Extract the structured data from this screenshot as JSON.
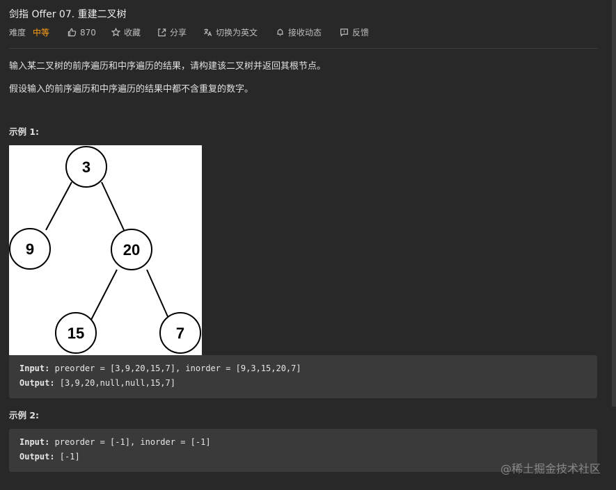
{
  "problem": {
    "title": "剑指 Offer 07. 重建二叉树",
    "difficulty_label": "难度",
    "difficulty_value": "中等",
    "likes": "870",
    "favorite_label": "收藏",
    "share_label": "分享",
    "language_label": "切换为英文",
    "notify_label": "接收动态",
    "feedback_label": "反馈"
  },
  "description": {
    "para1": "输入某二叉树的前序遍历和中序遍历的结果，请构建该二叉树并返回其根节点。",
    "para2": "假设输入的前序遍历和中序遍历的结果中都不含重复的数字。"
  },
  "examples": [
    {
      "heading": "示例 1:",
      "input_key": "Input:",
      "input_value": " preorder = [3,9,20,15,7], inorder = [9,3,15,20,7]",
      "output_key": "Output:",
      "output_value": " [3,9,20,null,null,15,7]",
      "tree_nodes": [
        "3",
        "9",
        "20",
        "15",
        "7"
      ]
    },
    {
      "heading": "示例 2:",
      "input_key": "Input:",
      "input_value": " preorder = [-1], inorder = [-1]",
      "output_key": "Output:",
      "output_value": " [-1]"
    }
  ],
  "watermark": "@稀土掘金技术社区",
  "icons": {
    "like": "thumbs-up-icon",
    "favorite": "star-icon",
    "share": "share-icon",
    "language": "translate-icon",
    "notify": "bell-icon",
    "feedback": "feedback-icon"
  },
  "colors": {
    "background": "#282828",
    "difficulty": "#ffa116",
    "code_background": "#3a3a3a"
  }
}
